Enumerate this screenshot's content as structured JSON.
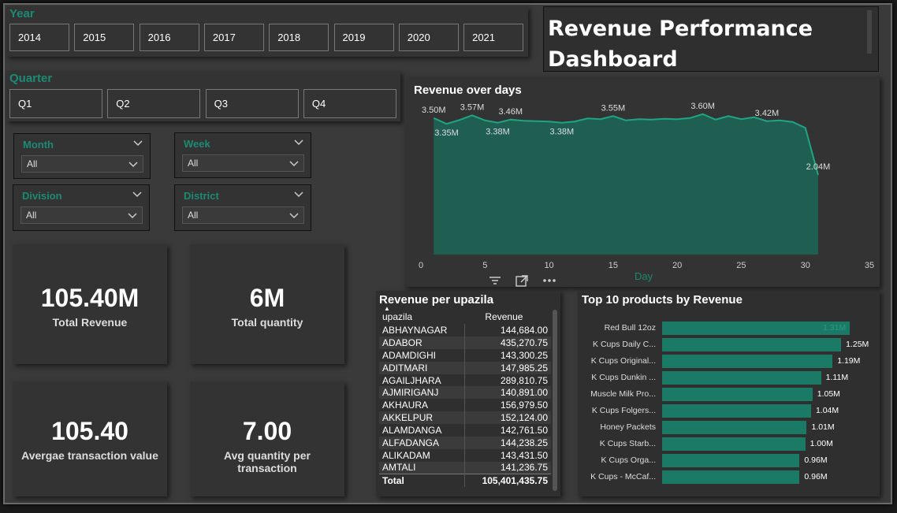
{
  "dashboard": {
    "title_line1": "Revenue Performance",
    "title_line2": "Dashboard"
  },
  "year_slicer": {
    "title": "Year",
    "options": [
      "2014",
      "2015",
      "2016",
      "2017",
      "2018",
      "2019",
      "2020",
      "2021"
    ]
  },
  "quarter_slicer": {
    "title": "Quarter",
    "options": [
      "Q1",
      "Q2",
      "Q3",
      "Q4"
    ]
  },
  "dropdowns": {
    "month": {
      "label": "Month",
      "value": "All"
    },
    "week": {
      "label": "Week",
      "value": "All"
    },
    "division": {
      "label": "Division",
      "value": "All"
    },
    "district": {
      "label": "District",
      "value": "All"
    }
  },
  "kpis": {
    "total_revenue": {
      "value": "105.40M",
      "label": "Total Revenue"
    },
    "total_quantity": {
      "value": "6M",
      "label": "Total quantity"
    },
    "avg_transaction": {
      "value": "105.40",
      "label": "Avergae transaction value"
    },
    "avg_quantity": {
      "value": "7.00",
      "label": "Avg quantity per transaction"
    }
  },
  "visual_header_icons": [
    "filter-icon",
    "focus-mode-icon",
    "more-options-icon"
  ],
  "colors": {
    "accent": "#1c8a74",
    "area_fill": "#1f5f52",
    "line": "#1fa585",
    "bar": "#1a7a66"
  },
  "chart_data": [
    {
      "type": "area",
      "title": "Revenue over days",
      "xlabel": "Day",
      "ylabel": "",
      "xlim": [
        0,
        35
      ],
      "ylim": [
        0,
        3.9
      ],
      "xticks": [
        "0",
        "5",
        "10",
        "15",
        "20",
        "25",
        "30",
        "35"
      ],
      "grid": false,
      "series": [
        {
          "unit": "M",
          "x": [
            1,
            2,
            3,
            4,
            5,
            6,
            7,
            8,
            9,
            10,
            11,
            12,
            13,
            14,
            15,
            16,
            17,
            18,
            19,
            20,
            21,
            22,
            23,
            24,
            25,
            26,
            27,
            28,
            29,
            30,
            31
          ],
          "values": [
            3.5,
            3.35,
            3.45,
            3.57,
            3.44,
            3.38,
            3.46,
            3.43,
            3.42,
            3.41,
            3.38,
            3.41,
            3.49,
            3.47,
            3.55,
            3.44,
            3.47,
            3.46,
            3.48,
            3.47,
            3.5,
            3.6,
            3.46,
            3.55,
            3.47,
            3.52,
            3.42,
            3.44,
            3.4,
            3.25,
            2.04
          ]
        }
      ],
      "data_labels": [
        {
          "x": 1,
          "text": "3.50M",
          "pos": "above"
        },
        {
          "x": 2,
          "text": "3.35M",
          "pos": "below"
        },
        {
          "x": 4,
          "text": "3.57M",
          "pos": "above"
        },
        {
          "x": 6,
          "text": "3.38M",
          "pos": "below"
        },
        {
          "x": 7,
          "text": "3.46M",
          "pos": "above"
        },
        {
          "x": 11,
          "text": "3.38M",
          "pos": "below"
        },
        {
          "x": 15,
          "text": "3.55M",
          "pos": "above"
        },
        {
          "x": 22,
          "text": "3.60M",
          "pos": "above"
        },
        {
          "x": 27,
          "text": "3.42M",
          "pos": "above"
        },
        {
          "x": 31,
          "text": "2.04M",
          "pos": "above"
        }
      ]
    },
    {
      "type": "bar",
      "orientation": "horizontal",
      "title": "Top 10 products by Revenue",
      "categories": [
        "Red Bull 12oz",
        "K Cups Daily C...",
        "K Cups Original...",
        "K Cups Dunkin ...",
        "Muscle Milk Pro...",
        "K Cups Folgers...",
        "Honey Packets",
        "K Cups  Starb...",
        "K Cups Orga...",
        "K Cups - McCaf..."
      ],
      "values": [
        1.31,
        1.25,
        1.19,
        1.11,
        1.05,
        1.04,
        1.01,
        1.0,
        0.96,
        0.96
      ],
      "value_labels": [
        "1.31M",
        "1.25M",
        "1.19M",
        "1.11M",
        "1.05M",
        "1.04M",
        "1.01M",
        "1.00M",
        "0.96M",
        "0.96M"
      ],
      "xlim": [
        0,
        1.31
      ]
    },
    {
      "type": "table",
      "title": "Revenue per upazila",
      "columns": [
        "upazila",
        "Revenue"
      ],
      "rows": [
        [
          "ABHAYNAGAR",
          "144,684.00"
        ],
        [
          "ADABOR",
          "435,270.75"
        ],
        [
          "ADAMDIGHI",
          "143,300.25"
        ],
        [
          "ADITMARI",
          "147,985.25"
        ],
        [
          "AGAILJHARA",
          "289,810.75"
        ],
        [
          "AJMIRIGANJ",
          "140,891.00"
        ],
        [
          "AKHAURA",
          "156,979.50"
        ],
        [
          "AKKELPUR",
          "152,124.00"
        ],
        [
          "ALAMDANGA",
          "142,761.50"
        ],
        [
          "ALFADANGA",
          "144,238.25"
        ],
        [
          "ALIKADAM",
          "143,431.50"
        ],
        [
          "AMTALI",
          "141,236.75"
        ]
      ],
      "total_label": "Total",
      "total_value": "105,401,435.75"
    }
  ]
}
